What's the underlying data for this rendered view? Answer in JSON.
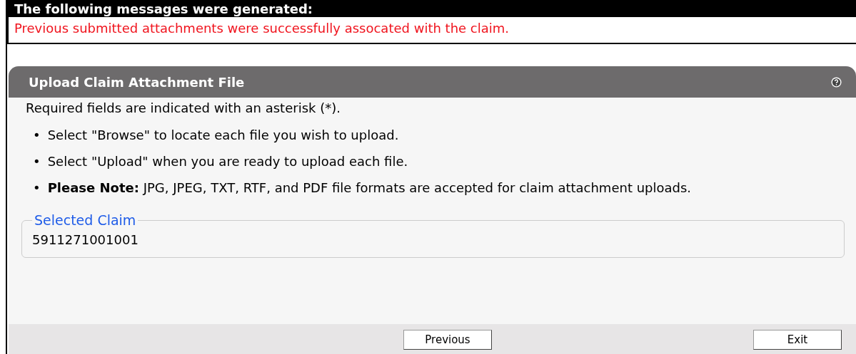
{
  "messages": {
    "title": "The following messages were generated:",
    "items": [
      "Previous submitted attachments were successfully assocated with the claim."
    ]
  },
  "panel": {
    "title": "Upload Claim Attachment File",
    "intro": "Required fields are indicated with an asterisk (*).",
    "bullets": [
      {
        "marker": "•",
        "text": "Select \"Browse\" to locate each file you wish to upload."
      },
      {
        "marker": "•",
        "text": "Select \"Upload\" when you are ready to upload each file."
      },
      {
        "marker": "•",
        "text": "**Please Note:** JPG, JPEG, TXT, RTF, and PDF file formats are accepted for claim attachment uploads."
      }
    ],
    "selected_claim": {
      "legend": "Selected Claim",
      "value": "5911271001001"
    }
  },
  "buttons": [
    "Previous",
    "Exit"
  ]
}
